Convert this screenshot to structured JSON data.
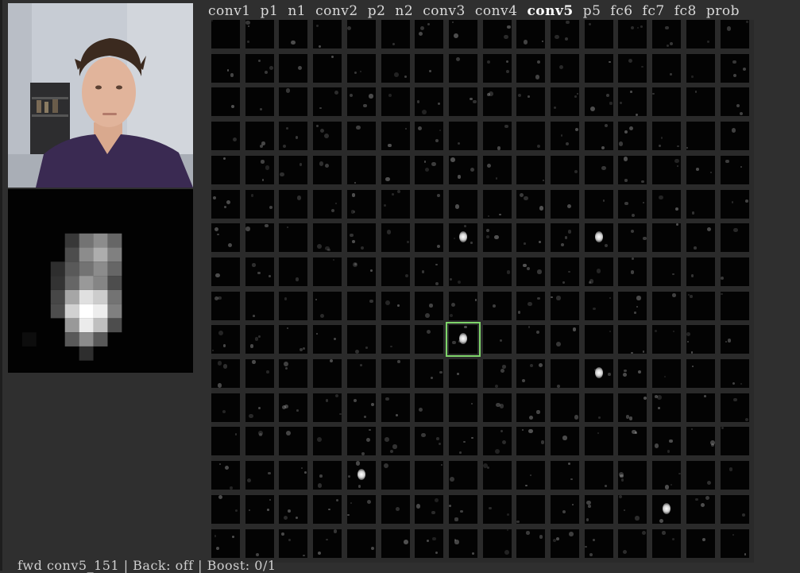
{
  "layer_bar": {
    "layers": [
      {
        "name": "conv1",
        "active": false
      },
      {
        "name": "p1",
        "active": false
      },
      {
        "name": "n1",
        "active": false
      },
      {
        "name": "conv2",
        "active": false
      },
      {
        "name": "p2",
        "active": false
      },
      {
        "name": "n2",
        "active": false
      },
      {
        "name": "conv3",
        "active": false
      },
      {
        "name": "conv4",
        "active": false
      },
      {
        "name": "conv5",
        "active": true
      },
      {
        "name": "p5",
        "active": false
      },
      {
        "name": "fc6",
        "active": false
      },
      {
        "name": "fc7",
        "active": false
      },
      {
        "name": "fc8",
        "active": false
      },
      {
        "name": "prob",
        "active": false
      }
    ]
  },
  "status_bar": {
    "text": "fwd conv5_151 | Back: off | Boost: 0/1"
  },
  "grid": {
    "rows": 16,
    "cols": 16,
    "selected_tile": {
      "row": 9,
      "col": 7
    },
    "bright_tiles": [
      {
        "row": 9,
        "col": 7
      },
      {
        "row": 10,
        "col": 11
      },
      {
        "row": 6,
        "col": 11
      },
      {
        "row": 6,
        "col": 7
      },
      {
        "row": 14,
        "col": 13
      },
      {
        "row": 13,
        "col": 4
      }
    ]
  },
  "zoom_view": {
    "grid_cols": 13,
    "grid_rows": 13,
    "cells": [
      [
        4,
        1,
        0.22
      ],
      [
        5,
        1,
        0.45
      ],
      [
        6,
        1,
        0.55
      ],
      [
        7,
        1,
        0.4
      ],
      [
        4,
        2,
        0.3
      ],
      [
        5,
        2,
        0.55
      ],
      [
        6,
        2,
        0.68
      ],
      [
        7,
        2,
        0.5
      ],
      [
        3,
        3,
        0.18
      ],
      [
        4,
        3,
        0.35
      ],
      [
        5,
        3,
        0.45
      ],
      [
        6,
        3,
        0.55
      ],
      [
        7,
        3,
        0.4
      ],
      [
        3,
        4,
        0.2
      ],
      [
        4,
        4,
        0.4
      ],
      [
        5,
        4,
        0.6
      ],
      [
        6,
        4,
        0.52
      ],
      [
        7,
        4,
        0.3
      ],
      [
        3,
        5,
        0.28
      ],
      [
        4,
        5,
        0.65
      ],
      [
        5,
        5,
        0.88
      ],
      [
        6,
        5,
        0.8
      ],
      [
        7,
        5,
        0.45
      ],
      [
        3,
        6,
        0.3
      ],
      [
        4,
        6,
        0.82
      ],
      [
        5,
        6,
        1.0
      ],
      [
        6,
        6,
        0.93
      ],
      [
        7,
        6,
        0.5
      ],
      [
        4,
        7,
        0.6
      ],
      [
        5,
        7,
        0.92
      ],
      [
        6,
        7,
        0.75
      ],
      [
        7,
        7,
        0.3
      ],
      [
        4,
        8,
        0.35
      ],
      [
        5,
        8,
        0.55
      ],
      [
        6,
        8,
        0.35
      ],
      [
        5,
        9,
        0.18
      ],
      [
        1,
        8,
        0.05
      ]
    ]
  }
}
